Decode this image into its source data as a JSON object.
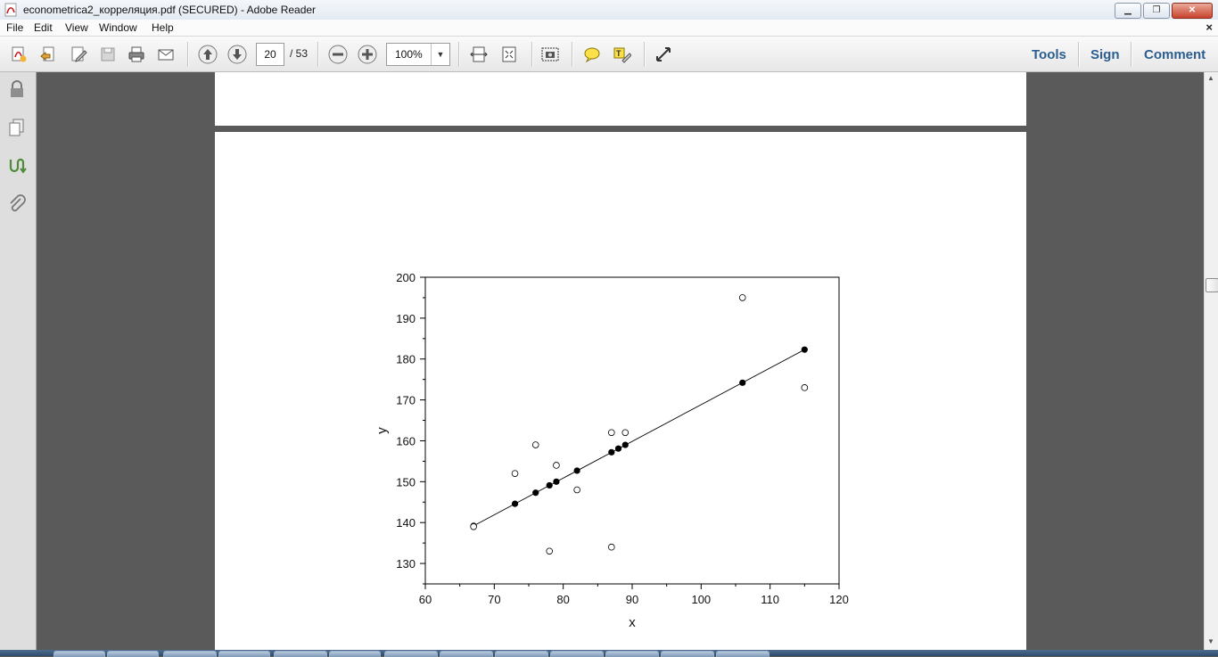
{
  "window": {
    "title": "econometrica2_корреляция.pdf (SECURED) - Adobe Reader"
  },
  "menu": {
    "file": "File",
    "edit": "Edit",
    "view": "View",
    "window": "Window",
    "help": "Help",
    "close_glyph": "×"
  },
  "toolbar": {
    "page_current": "20",
    "page_total": "/ 53",
    "zoom": "100%",
    "tools": "Tools",
    "sign": "Sign",
    "comment": "Comment",
    "icons": [
      "create-pdf-icon",
      "open-icon",
      "edit-icon",
      "save-icon",
      "print-icon",
      "email-icon",
      "prev-page-icon",
      "next-page-icon",
      "zoom-out-icon",
      "zoom-in-icon",
      "fit-width-icon",
      "fit-page-icon",
      "snapshot-icon",
      "sticky-note-icon",
      "highlight-icon",
      "full-screen-icon"
    ]
  },
  "left_panel": {
    "icons": [
      "lock-icon",
      "pages-icon",
      "signatures-icon",
      "attachments-icon"
    ]
  },
  "chart_data": {
    "type": "scatter",
    "xlabel": "x",
    "ylabel": "y",
    "xlim": [
      60,
      120
    ],
    "ylim": [
      125,
      200
    ],
    "x_ticks": [
      "60",
      "70",
      "80",
      "90",
      "100",
      "110",
      "120"
    ],
    "y_ticks": [
      "130",
      "140",
      "150",
      "160",
      "170",
      "180",
      "190",
      "200"
    ],
    "series": [
      {
        "marker": "filled",
        "points": [
          [
            67,
            139.2
          ],
          [
            73,
            144.6
          ],
          [
            76,
            147.3
          ],
          [
            78,
            149.1
          ],
          [
            79,
            150
          ],
          [
            82,
            152.7
          ],
          [
            87,
            157.2
          ],
          [
            88,
            158.1
          ],
          [
            89,
            159
          ],
          [
            106,
            174.2
          ],
          [
            115,
            182.3
          ]
        ]
      },
      {
        "marker": "open",
        "points": [
          [
            67,
            139
          ],
          [
            73,
            152
          ],
          [
            76,
            159
          ],
          [
            78,
            133
          ],
          [
            79,
            154
          ],
          [
            82,
            148
          ],
          [
            87,
            162
          ],
          [
            87,
            134
          ],
          [
            89,
            162
          ],
          [
            106,
            195
          ],
          [
            115,
            173
          ]
        ]
      }
    ],
    "fit_line": {
      "x": [
        67,
        115
      ],
      "y": [
        139.2,
        182.3
      ]
    }
  }
}
